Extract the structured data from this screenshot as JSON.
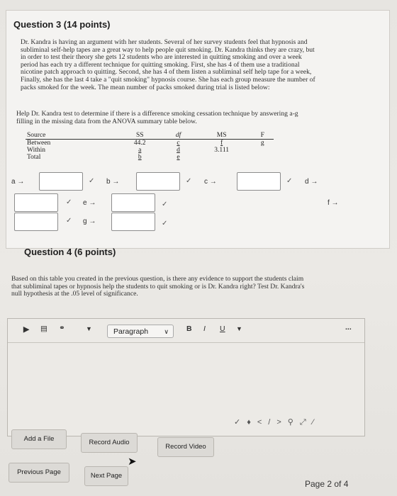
{
  "question3": {
    "title": "Question 3 (14 points)",
    "lines": [
      "Dr. Kandra is having an argument with her students. Several of her survey students feel that hypnosis and",
      "subliminal self-help tapes are a great way to help people quit smoking. Dr. Kandra thinks they are crazy, but",
      "in order to test their theory she gets 12 students who are interested in quitting smoking and over a week",
      "period has each try a different technique for quitting smoking. First, she has 4 of them use a traditional",
      "nicotine patch approach to quitting. Second, she has 4 of them listen a subliminal self help tape for a week,",
      "Finally, she has the last 4 take a \"quit smoking\" hypnosis course. She has each group measure the number of",
      "packs smoked for the week. The mean number of packs smoked during trial is listed below:"
    ],
    "help_lines": [
      "Help Dr. Kandra test to determine if there is a difference smoking cessation technique by answering a-g",
      "filling in the missing data from the ANOVA summary table below."
    ],
    "table": {
      "headers": [
        "Source",
        "SS",
        "df",
        "MS",
        "F"
      ],
      "rows": [
        [
          "Between",
          "44.2",
          "c",
          "f",
          "g"
        ],
        [
          "Within",
          "a",
          "d",
          "3.111",
          ""
        ],
        [
          "Total",
          "b",
          "e",
          "",
          ""
        ]
      ]
    },
    "answer_labels": {
      "a": "a →",
      "b": "b →",
      "c": "c →",
      "d": "d →",
      "e": "e →",
      "f": "f →",
      "g": "g →"
    },
    "answers": {
      "a": "",
      "b": "",
      "c": "",
      "d": "",
      "e": "",
      "f": "",
      "g": ""
    }
  },
  "question4": {
    "title": "Question 4 (6 points)",
    "lines": [
      "Based on this table you created in the previous question, is there any evidence to support the students claim",
      "that subliminal tapes or hypnosis help the students to quit smoking or is Dr. Kandra right? Test Dr. Kandra's",
      "null hypothesis at the .05 level of significance."
    ]
  },
  "editor": {
    "format_select": "Paragraph",
    "bold": "B",
    "italic": "I",
    "underline": "U",
    "more": "...",
    "content": ""
  },
  "buttons": {
    "add_file": "Add a File",
    "record_audio": "Record Audio",
    "record_video": "Record Video",
    "previous_page": "Previous Page",
    "next_page": "Next Page"
  },
  "pagination": {
    "label": "Page 2 of 4"
  },
  "icons": [
    "spellcheck-icon",
    "link-icon",
    "insert-icon",
    "format-icon",
    "code-icon",
    "find-icon",
    "fullscreen-icon",
    "resize-icon"
  ]
}
